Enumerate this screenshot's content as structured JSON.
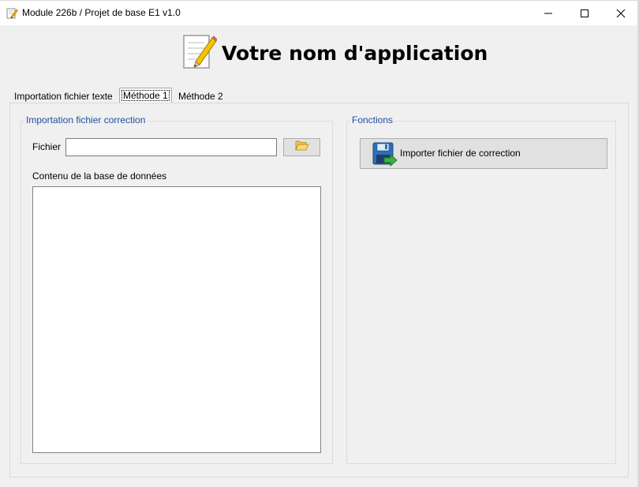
{
  "window": {
    "title": "Module 226b / Projet de base E1 v1.0",
    "icon": "notepad-pencil-icon",
    "controls": {
      "minimize": "—",
      "close": "✕"
    }
  },
  "header": {
    "app_title": "Votre nom d'application",
    "icon": "notepad-pencil-icon"
  },
  "tabs": [
    {
      "label": "Importation fichier texte",
      "selected": false
    },
    {
      "label": "Méthode 1",
      "selected": true
    },
    {
      "label": "Méthode 2",
      "selected": false
    }
  ],
  "left_group": {
    "title": "Importation fichier correction",
    "file_label": "Fichier",
    "file_value": "",
    "browse_icon": "folder-open-icon",
    "db_content_label": "Contenu de la base de données",
    "db_content_value": ""
  },
  "right_group": {
    "title": "Fonctions",
    "import_button_label": "Importer fichier de correction",
    "import_button_icon": "floppy-disk-arrow-icon"
  },
  "colors": {
    "group_title": "#1e4ea0",
    "background": "#f0f0f0"
  }
}
